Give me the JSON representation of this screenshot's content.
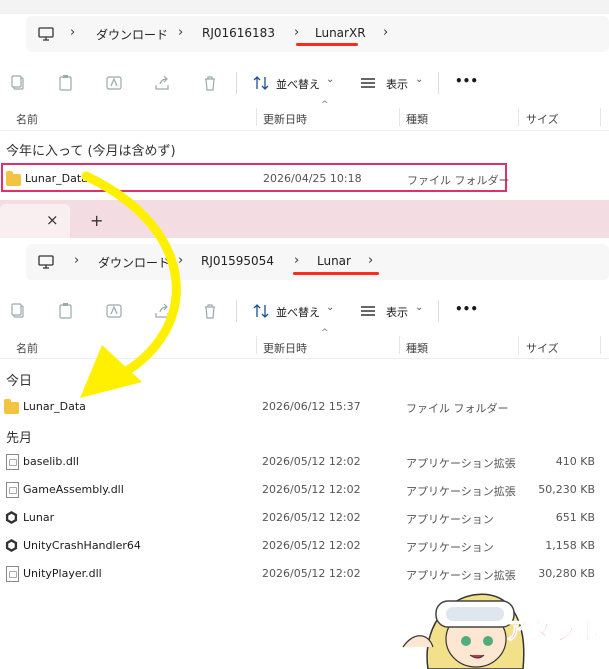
{
  "top": {
    "breadcrumb": [
      "ダウンロード",
      "RJ01616183",
      "LunarXR"
    ],
    "toolbar": {
      "sort_label": "並べ替え",
      "view_label": "表示",
      "more": "•••"
    },
    "columns": [
      "名前",
      "更新日時",
      "種類",
      "サイズ"
    ],
    "group": "今年に入って (今月は含めず)",
    "row": {
      "name": "Lunar_Data",
      "date": "2026/04/25 10:18",
      "type": "ファイル フォルダー"
    }
  },
  "bottom": {
    "tab_close": "×",
    "tab_add": "+",
    "breadcrumb": [
      "ダウンロード",
      "RJ01595054",
      "Lunar"
    ],
    "toolbar": {
      "sort_label": "並べ替え",
      "view_label": "表示",
      "more": "•••"
    },
    "columns": [
      "名前",
      "更新日時",
      "種類",
      "サイズ"
    ],
    "group_today": "今日",
    "today_row": {
      "name": "Lunar_Data",
      "date": "2026/06/12 15:37",
      "type": "ファイル フォルダー"
    },
    "group_lastmonth": "先月",
    "rows": [
      {
        "name": "baselib.dll",
        "date": "2026/05/12 12:02",
        "type": "アプリケーション拡張",
        "size": "410 KB",
        "icon": "dll-file-icon"
      },
      {
        "name": "GameAssembly.dll",
        "date": "2026/05/12 12:02",
        "type": "アプリケーション拡張",
        "size": "50,230 KB",
        "icon": "dll-file-icon"
      },
      {
        "name": "Lunar",
        "date": "2026/05/12 12:02",
        "type": "アプリケーション",
        "size": "651 KB",
        "icon": "unity-app-icon"
      },
      {
        "name": "UnityCrashHandler64",
        "date": "2026/05/12 12:02",
        "type": "アプリケーション",
        "size": "1,158 KB",
        "icon": "unity-app-icon"
      },
      {
        "name": "UnityPlayer.dll",
        "date": "2026/05/12 12:02",
        "type": "アプリケーション拡張",
        "size": "30,280 KB",
        "icon": "dll-file-icon"
      }
    ]
  },
  "watermark": {
    "logo": "アダラボ"
  },
  "colors": {
    "highlight": "#e0306e",
    "underline": "#ff2a1a",
    "arrow": "#ffef00",
    "tab_bg": "#f3dde2"
  }
}
